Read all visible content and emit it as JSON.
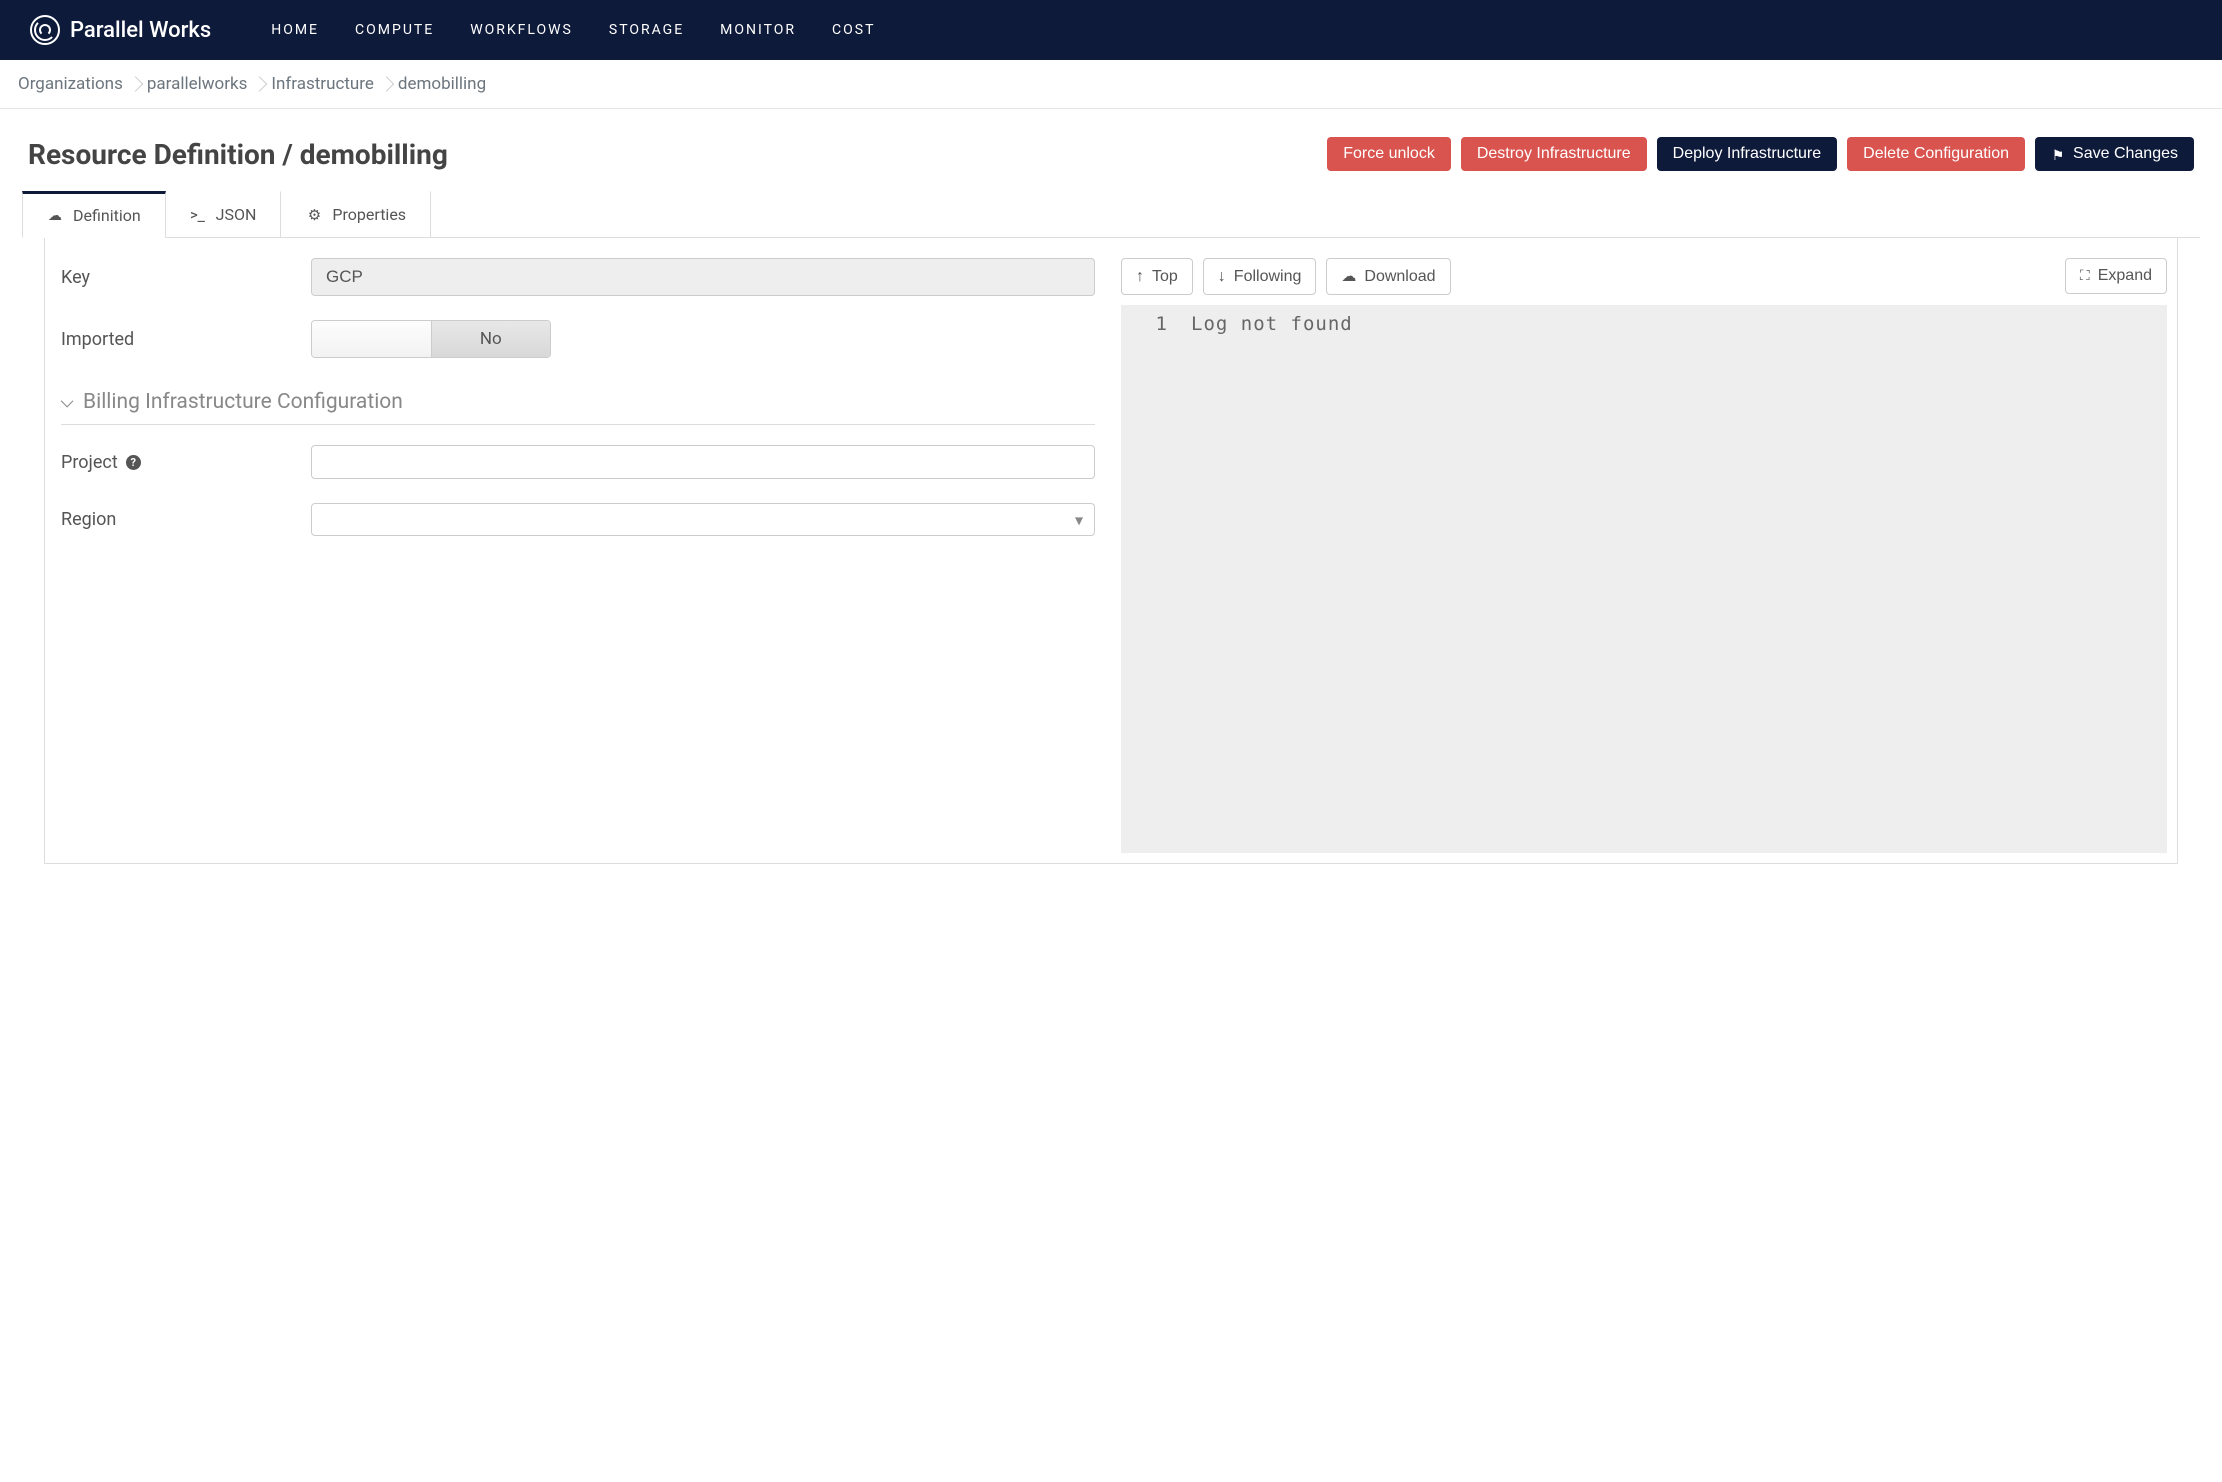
{
  "brand": {
    "name": "Parallel Works"
  },
  "nav": {
    "items": [
      {
        "label": "HOME"
      },
      {
        "label": "COMPUTE"
      },
      {
        "label": "WORKFLOWS"
      },
      {
        "label": "STORAGE"
      },
      {
        "label": "MONITOR"
      },
      {
        "label": "COST"
      }
    ]
  },
  "breadcrumb": {
    "items": [
      {
        "label": "Organizations"
      },
      {
        "label": "parallelworks"
      },
      {
        "label": "Infrastructure"
      },
      {
        "label": "demobilling"
      }
    ]
  },
  "page": {
    "title": "Resource Definition / demobilling"
  },
  "actions": {
    "force_unlock": "Force unlock",
    "destroy": "Destroy Infrastructure",
    "deploy": "Deploy Infrastructure",
    "delete": "Delete Configuration",
    "save": "Save Changes"
  },
  "tabs": {
    "items": [
      {
        "label": "Definition",
        "icon": "cloud",
        "active": true
      },
      {
        "label": "JSON",
        "icon": "code",
        "active": false
      },
      {
        "label": "Properties",
        "icon": "gear",
        "active": false
      }
    ]
  },
  "form": {
    "key_label": "Key",
    "key_value": "GCP",
    "imported_label": "Imported",
    "imported_value": "No",
    "section_title": "Billing Infrastructure Configuration",
    "project_label": "Project",
    "project_value": "",
    "region_label": "Region",
    "region_value": ""
  },
  "log_toolbar": {
    "top": "Top",
    "following": "Following",
    "download": "Download",
    "expand": "Expand"
  },
  "log": {
    "lines": [
      {
        "num": "1",
        "text": "Log not found"
      }
    ]
  }
}
